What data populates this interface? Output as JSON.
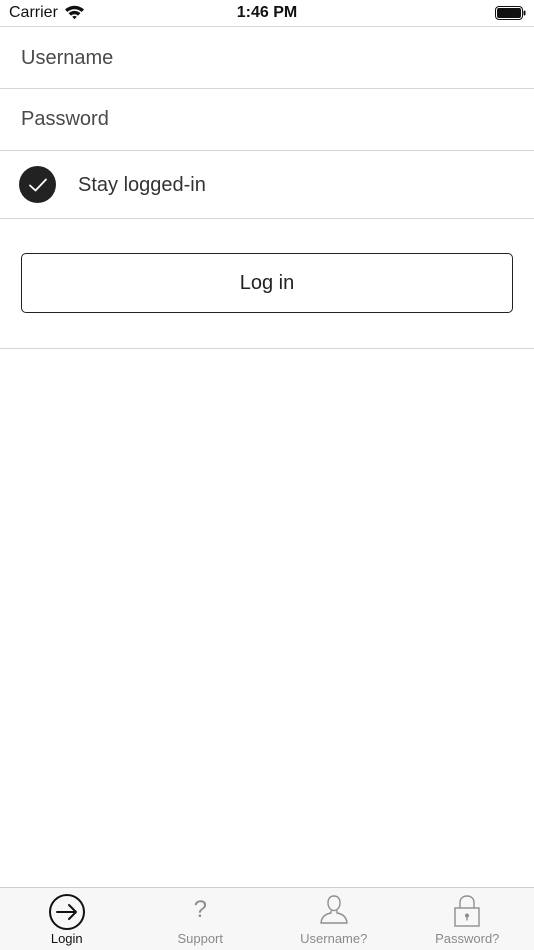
{
  "status_bar": {
    "carrier": "Carrier",
    "time": "1:46 PM",
    "icons": [
      "wifi-icon",
      "battery-icon"
    ]
  },
  "form": {
    "username_placeholder": "Username",
    "username_value": "",
    "password_placeholder": "Password",
    "password_value": "",
    "stay_logged_in_label": "Stay logged-in",
    "stay_logged_in_checked": true
  },
  "login_button": {
    "label": "Log in"
  },
  "tab_bar": {
    "tabs": [
      {
        "label": "Login",
        "icon": "login-arrow-icon",
        "active": true
      },
      {
        "label": "Support",
        "icon": "question-mark-icon",
        "active": false
      },
      {
        "label": "Username?",
        "icon": "person-icon",
        "active": false
      },
      {
        "label": "Password?",
        "icon": "lock-icon",
        "active": false
      }
    ]
  },
  "colors": {
    "accent": "#222222",
    "divider": "#d6d6d6",
    "tab_inactive": "#8a8a8a",
    "tab_bar_bg": "#f7f7f7"
  }
}
